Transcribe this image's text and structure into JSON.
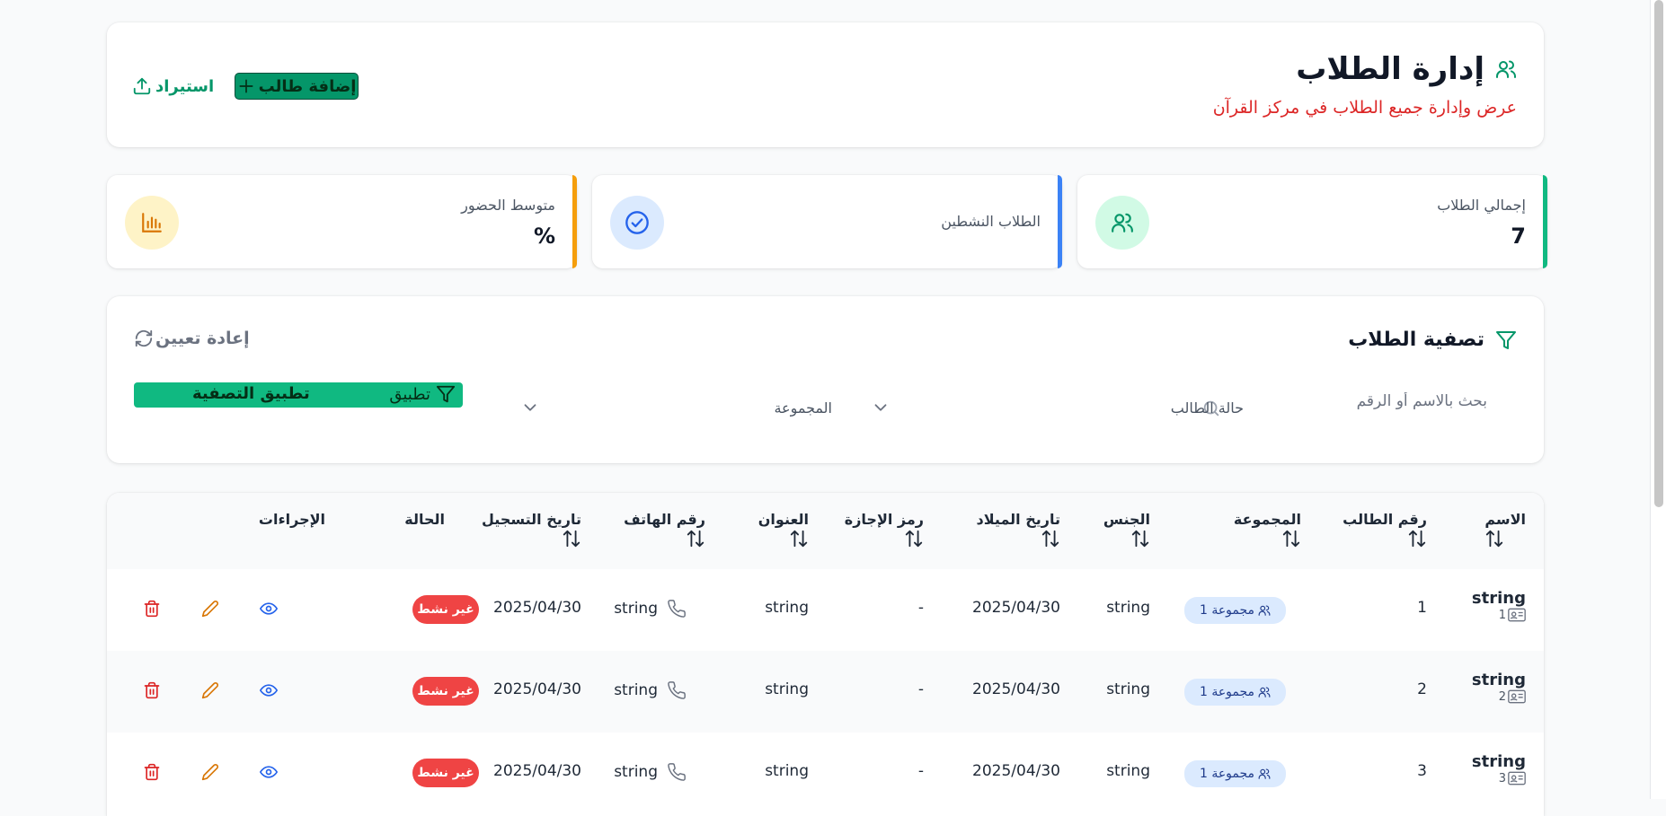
{
  "header": {
    "title": "إدارة الطلاب",
    "subtitle": "عرض وإدارة جميع الطلاب في مركز القرآن",
    "add_label": "إضافة طالب",
    "import_label": "استيراد"
  },
  "stats": [
    {
      "label": "إجمالي الطلاب",
      "value": "7",
      "color": "#10b981",
      "icon": "users-icon"
    },
    {
      "label": "الطلاب النشطين",
      "value": "",
      "color": "#3b82f6",
      "icon": "check-circle-icon"
    },
    {
      "label": "متوسط الحضور",
      "value": "%",
      "color": "#f59e0b",
      "icon": "bar-chart-icon"
    }
  ],
  "filter": {
    "title": "تصفية الطلاب",
    "reset_label": "إعادة تعيين",
    "search_placeholder": "بحث بالاسم أو الرقم",
    "status_placeholder": "حالة الطالب",
    "group_placeholder": "المجموعة",
    "apply_label": "تطبيق التصفية",
    "apply_short": "تطبيق"
  },
  "table": {
    "columns": {
      "name": "الاسم",
      "id": "رقم الطالب",
      "group": "المجموعة",
      "gender": "الجنس",
      "dob": "تاريخ الميلاد",
      "license": "رمز الإجازة",
      "address": "العنوان",
      "phone": "رقم الهاتف",
      "reg_date": "تاريخ التسجيل",
      "status": "الحالة",
      "actions": "الإجراءات"
    },
    "rows": [
      {
        "name": "string",
        "sub": "1",
        "id": "1",
        "group": "مجموعة 1",
        "gender": "string",
        "dob": "2025/04/30",
        "license": "-",
        "address": "string",
        "phone": "string",
        "reg_date": "2025/04/30",
        "status": "غير نشط"
      },
      {
        "name": "string",
        "sub": "2",
        "id": "2",
        "group": "مجموعة 1",
        "gender": "string",
        "dob": "2025/04/30",
        "license": "-",
        "address": "string",
        "phone": "string",
        "reg_date": "2025/04/30",
        "status": "غير نشط"
      },
      {
        "name": "string",
        "sub": "3",
        "id": "3",
        "group": "مجموعة 1",
        "gender": "string",
        "dob": "2025/04/30",
        "license": "-",
        "address": "string",
        "phone": "string",
        "reg_date": "2025/04/30",
        "status": "غير نشط"
      }
    ]
  },
  "colors": {
    "primary": "#059669",
    "danger": "#ef4444",
    "badge_blue": "#dbeafe",
    "subtitle_red": "#dc2626"
  }
}
